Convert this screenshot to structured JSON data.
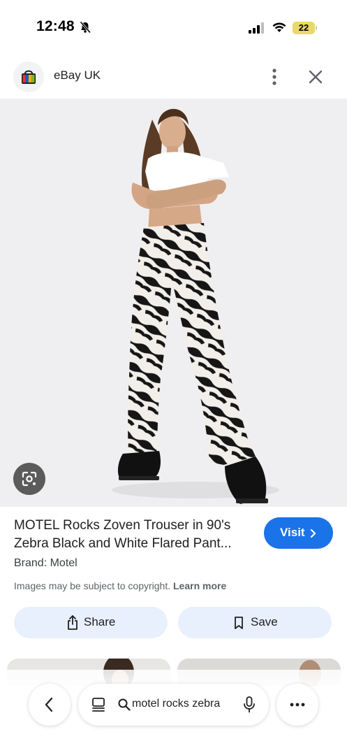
{
  "status_bar": {
    "time": "12:48",
    "battery": "22",
    "icons": [
      "bell-slash-icon",
      "signal-icon",
      "wifi-icon",
      "battery-icon"
    ]
  },
  "header": {
    "site_name": "eBay UK",
    "icons": [
      "ebay-logo-icon",
      "more-vert-icon",
      "close-icon"
    ]
  },
  "image": {
    "lens_icon": "google-lens-icon"
  },
  "product": {
    "title_line1": "MOTEL Rocks Zoven Trouser in 90's",
    "title_line2": "Zebra Black and White Flared Pant...",
    "visit_label": "Visit",
    "brand": "Brand: Motel",
    "copyright_text": "Images may be subject to copyright.",
    "learn_more": "Learn more"
  },
  "actions": {
    "share_label": "Share",
    "save_label": "Save"
  },
  "toolbar": {
    "query": "motel rocks zebra",
    "icons": [
      "back-icon",
      "tabs-icon",
      "search-icon",
      "mic-icon",
      "more-horiz-icon"
    ]
  },
  "colors": {
    "accent": "#1a73e8",
    "pill_bg": "#e8f0fe",
    "image_bg": "#efeff1"
  }
}
